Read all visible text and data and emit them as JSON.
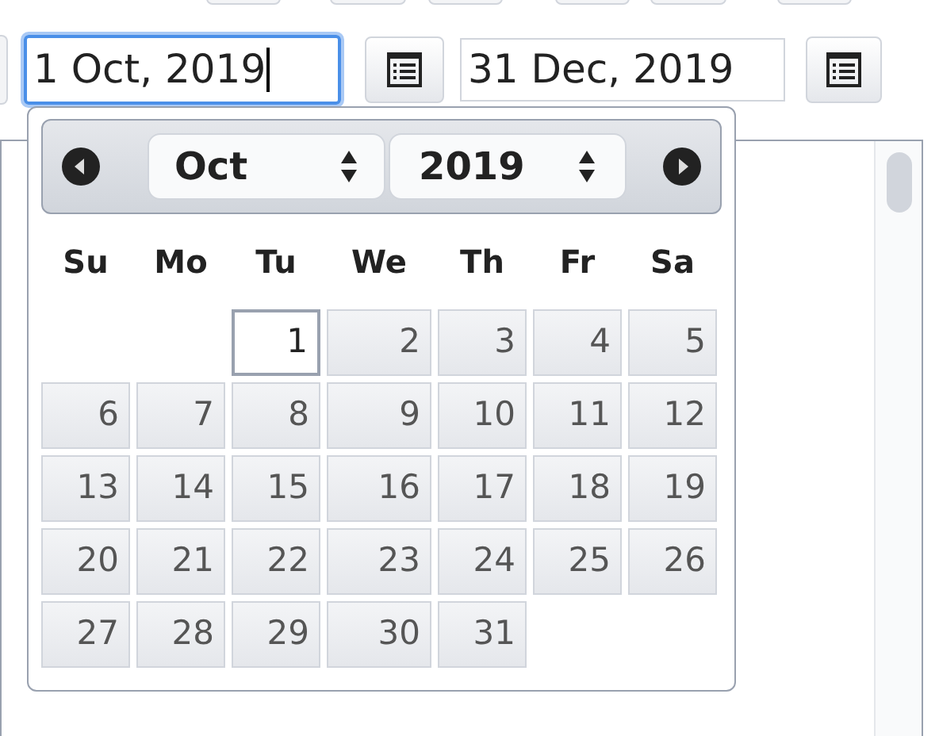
{
  "date_range": {
    "start": {
      "value": "1 Oct, 2019",
      "focused": true
    },
    "end": {
      "value": "31 Dec, 2019",
      "focused": false
    }
  },
  "datepicker": {
    "month": "Oct",
    "year": "2019",
    "weekdays": [
      "Su",
      "Mo",
      "Tu",
      "We",
      "Th",
      "Fr",
      "Sa"
    ],
    "days": [
      {
        "label": "1",
        "selected": true
      },
      {
        "label": "2",
        "selected": false
      },
      {
        "label": "3",
        "selected": false
      },
      {
        "label": "4",
        "selected": false
      },
      {
        "label": "5",
        "selected": false
      },
      {
        "label": "6",
        "selected": false
      },
      {
        "label": "7",
        "selected": false
      },
      {
        "label": "8",
        "selected": false
      },
      {
        "label": "9",
        "selected": false
      },
      {
        "label": "10",
        "selected": false
      },
      {
        "label": "11",
        "selected": false
      },
      {
        "label": "12",
        "selected": false
      },
      {
        "label": "13",
        "selected": false
      },
      {
        "label": "14",
        "selected": false
      },
      {
        "label": "15",
        "selected": false
      },
      {
        "label": "16",
        "selected": false
      },
      {
        "label": "17",
        "selected": false
      },
      {
        "label": "18",
        "selected": false
      },
      {
        "label": "19",
        "selected": false
      },
      {
        "label": "20",
        "selected": false
      },
      {
        "label": "21",
        "selected": false
      },
      {
        "label": "22",
        "selected": false
      },
      {
        "label": "23",
        "selected": false
      },
      {
        "label": "24",
        "selected": false
      },
      {
        "label": "25",
        "selected": false
      },
      {
        "label": "26",
        "selected": false
      },
      {
        "label": "27",
        "selected": false
      },
      {
        "label": "28",
        "selected": false
      },
      {
        "label": "29",
        "selected": false
      },
      {
        "label": "30",
        "selected": false
      },
      {
        "label": "31",
        "selected": false
      }
    ]
  }
}
